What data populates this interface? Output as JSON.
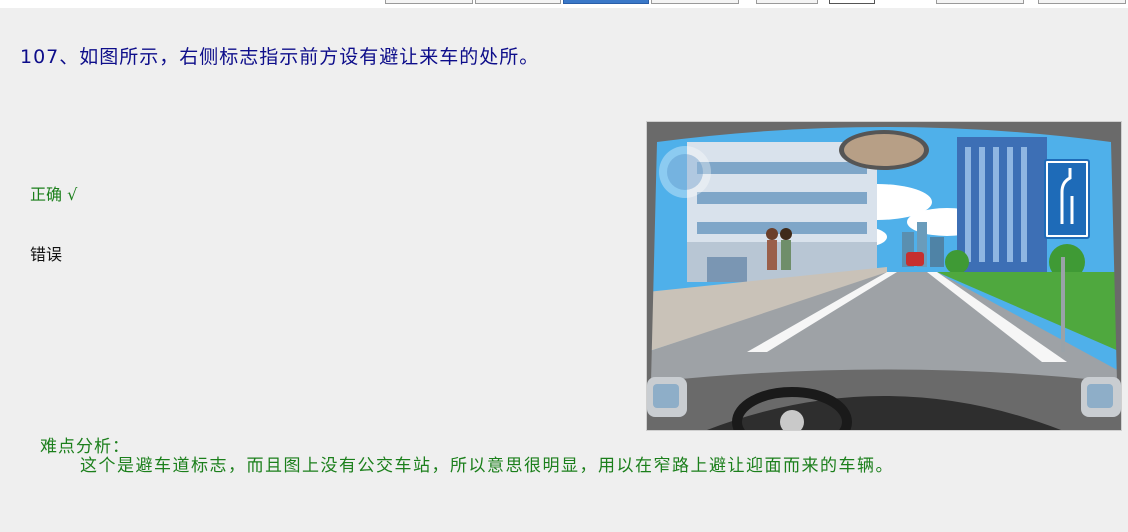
{
  "question": {
    "number": "107",
    "text": "、如图所示，右侧标志指示前方设有避让来车的处所。"
  },
  "options": {
    "correct_label": "正确",
    "correct_mark": "√",
    "wrong_label": "错误"
  },
  "analysis": {
    "title": "难点分析：",
    "body": "这个是避车道标志，而且图上没有公交车站，所以意思很明显，用以在窄路上避让迎面而来的车辆。"
  },
  "colors": {
    "question_text": "#0d0d8a",
    "answer_correct": "#1b7f1b",
    "analysis_text": "#1b7f1b",
    "sign_blue": "#1e6bb8"
  },
  "icons": {
    "road_sign": "road-narrow-curve-sign-icon"
  }
}
